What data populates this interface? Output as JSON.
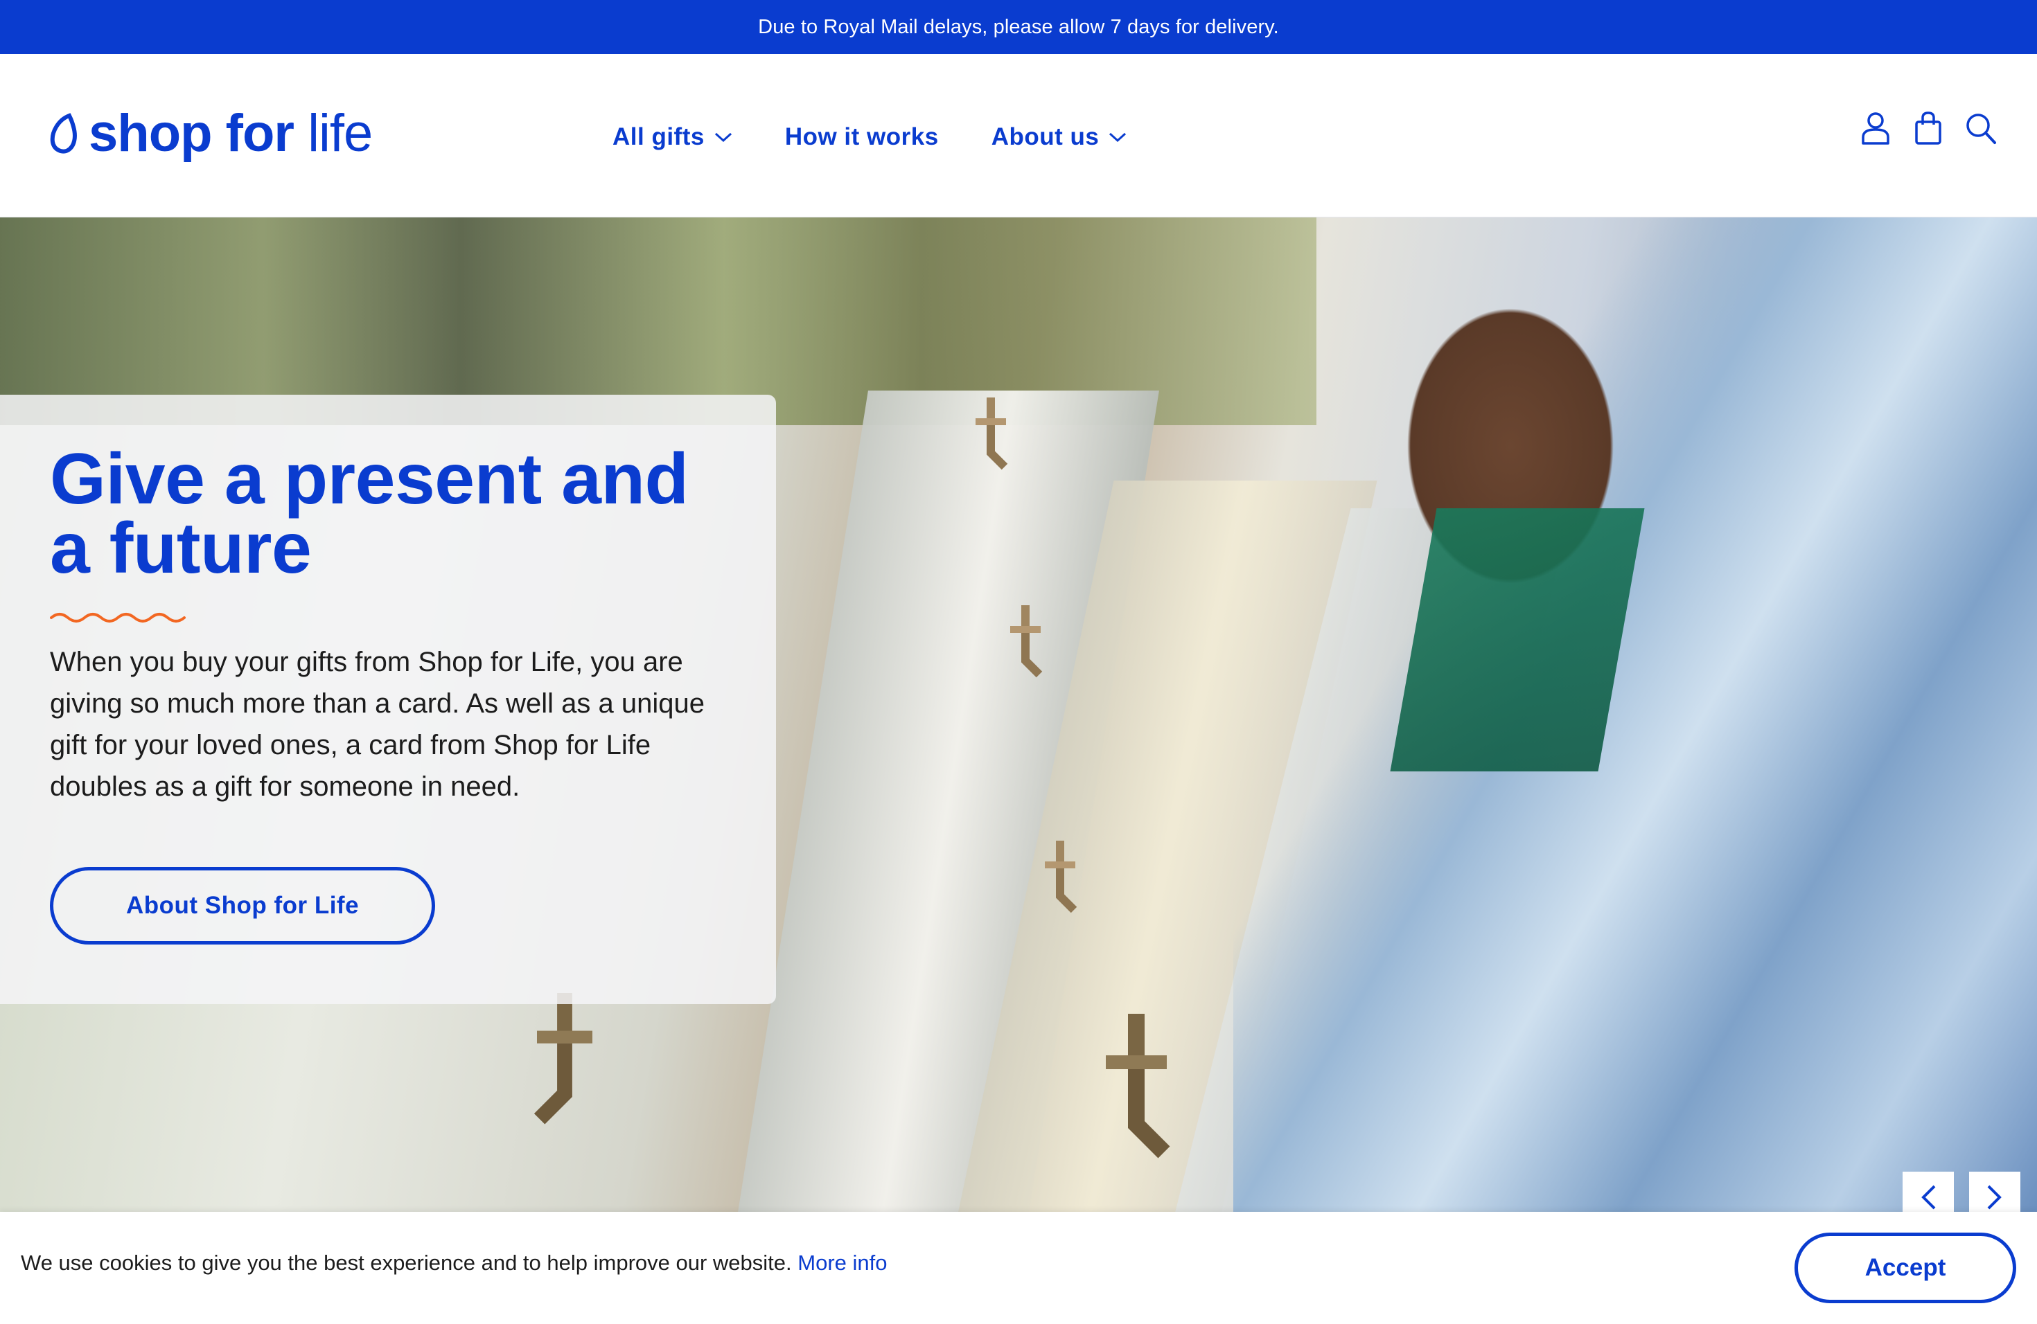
{
  "announcement": {
    "text": "Due to Royal Mail delays, please allow 7 days for delivery."
  },
  "brand": {
    "part1": "shop",
    "part2": "for",
    "part3": "life",
    "color": "#0a3ccf",
    "accent": "#f26722"
  },
  "nav": {
    "items": [
      {
        "label": "All gifts",
        "has_dropdown": true
      },
      {
        "label": "How it works",
        "has_dropdown": false
      },
      {
        "label": "About us",
        "has_dropdown": true
      }
    ]
  },
  "header_icons": [
    "account-icon",
    "basket-icon",
    "search-icon"
  ],
  "hero": {
    "title": "Give a present and a future",
    "body": "When you buy your gifts from Shop for Life, you are giving so much more than a card. As well as a unique gift for your loved ones, a card from Shop for Life doubles as a gift for someone in need.",
    "button_label": "About Shop for Life"
  },
  "carousel": {
    "prev_icon": "chevron-left-icon",
    "next_icon": "chevron-right-icon"
  },
  "cookie": {
    "text": "We use cookies to give you the best experience and to help improve our website.",
    "link_label": "More info",
    "accept_label": "Accept"
  }
}
